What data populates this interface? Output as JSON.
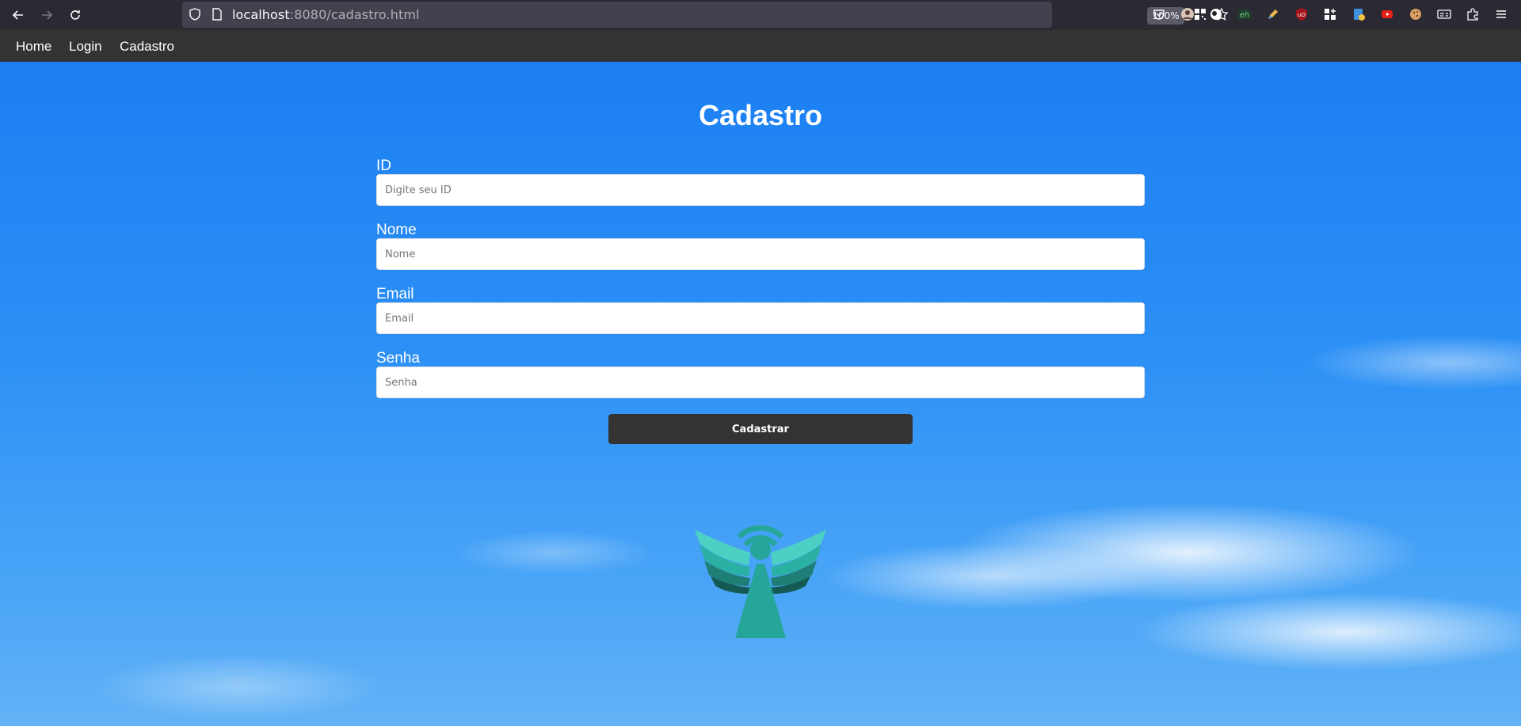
{
  "browser": {
    "url_host": "localhost",
    "url_rest": ":8080/cadastro.html",
    "zoom": "100%",
    "icons": [
      "back-icon",
      "forward-icon",
      "reload-icon",
      "shield-icon",
      "page-icon",
      "qr-code-icon",
      "bookmark-star-icon",
      "pocket-icon",
      "profile-icon",
      "extension-icon",
      "extension-eh-icon",
      "extension-pencil-icon",
      "ublock-icon",
      "extension-grid-icon",
      "extension-doc-icon",
      "youtube-icon",
      "cookie-icon",
      "extension-card-icon",
      "extensions-puzzle-icon",
      "menu-icon"
    ]
  },
  "nav": {
    "home": "Home",
    "login": "Login",
    "cadastro": "Cadastro"
  },
  "form": {
    "title": "Cadastro",
    "fields": [
      {
        "label": "ID",
        "placeholder": "Digite seu ID"
      },
      {
        "label": "Nome",
        "placeholder": "Nome"
      },
      {
        "label": "Email",
        "placeholder": "Email"
      },
      {
        "label": "Senha",
        "placeholder": "Senha"
      }
    ],
    "submit_label": "Cadastrar"
  },
  "colors": {
    "navbar": "#333333",
    "button": "#333333",
    "logo_teal": "#26a69a",
    "logo_wing": "#4dd0c4",
    "sky": "#2b8ff5"
  }
}
